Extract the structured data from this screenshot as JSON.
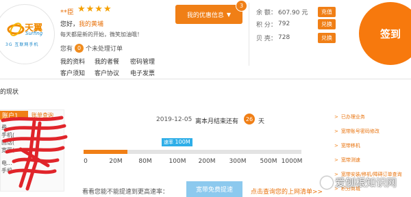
{
  "brand": {
    "name": "天翼",
    "sub": "Surfing",
    "tagline": "3G 互联网手机"
  },
  "profile": {
    "name": "**臣",
    "stars": "★★★★",
    "greeting_prefix": "您好，",
    "greeting_name": "我的黄埔",
    "motto": "每天都是新的开始，微笑加油哦！",
    "pending_prefix": "您有",
    "pending_count": "0",
    "pending_suffix": "个未处理订单",
    "links": [
      "我的资料",
      "我的者餐",
      "密码管理",
      "客户须知",
      "客户协议",
      "电子发票"
    ]
  },
  "promo": {
    "label": "我的优惠信息",
    "arrow": "▼",
    "badge": "3"
  },
  "account": {
    "rows": [
      {
        "label": "余 额：",
        "value": "607.90 元",
        "action": "充值"
      },
      {
        "label": "积 分：",
        "value": "792",
        "action": "兑换"
      },
      {
        "label": "贝 壳：",
        "value": "728",
        "action": "兑换"
      }
    ]
  },
  "signin_label": "签到",
  "section_title": "的现状",
  "sidebar": {
    "active_tab": "账户1",
    "tab_link": "账单查询",
    "lines": [
      "费...",
      "手机(",
      "固话(",
      "宽带(",
      "电...",
      "手机..."
    ]
  },
  "usage": {
    "date": "2019-12-05",
    "month_end_text": "离本月结束还有",
    "days_left": "26",
    "days_unit": "天",
    "rate_label": "速率",
    "rate_value": "100M",
    "rate_fraction": 0.2,
    "ticks": [
      "0",
      "20M",
      "80M",
      "100M",
      "200M",
      "300M",
      "500M",
      "1000M"
    ]
  },
  "footer": {
    "cant_text": "看看您能不能提速到更高速率：",
    "speedup_button": "宽带免费提速",
    "query_link": "点击查询您的上网清单>>"
  },
  "services": [
    "已办理业务",
    "宽带账号密码修改",
    "宽带移机",
    "宽带测速",
    "宽带安装/移机/障碍订单查询",
    "积分商城"
  ],
  "watermark": "爱刨根知识网",
  "colors": {
    "accent": "#f07f16",
    "blue": "#2eaee8",
    "link": "#e8730e"
  }
}
